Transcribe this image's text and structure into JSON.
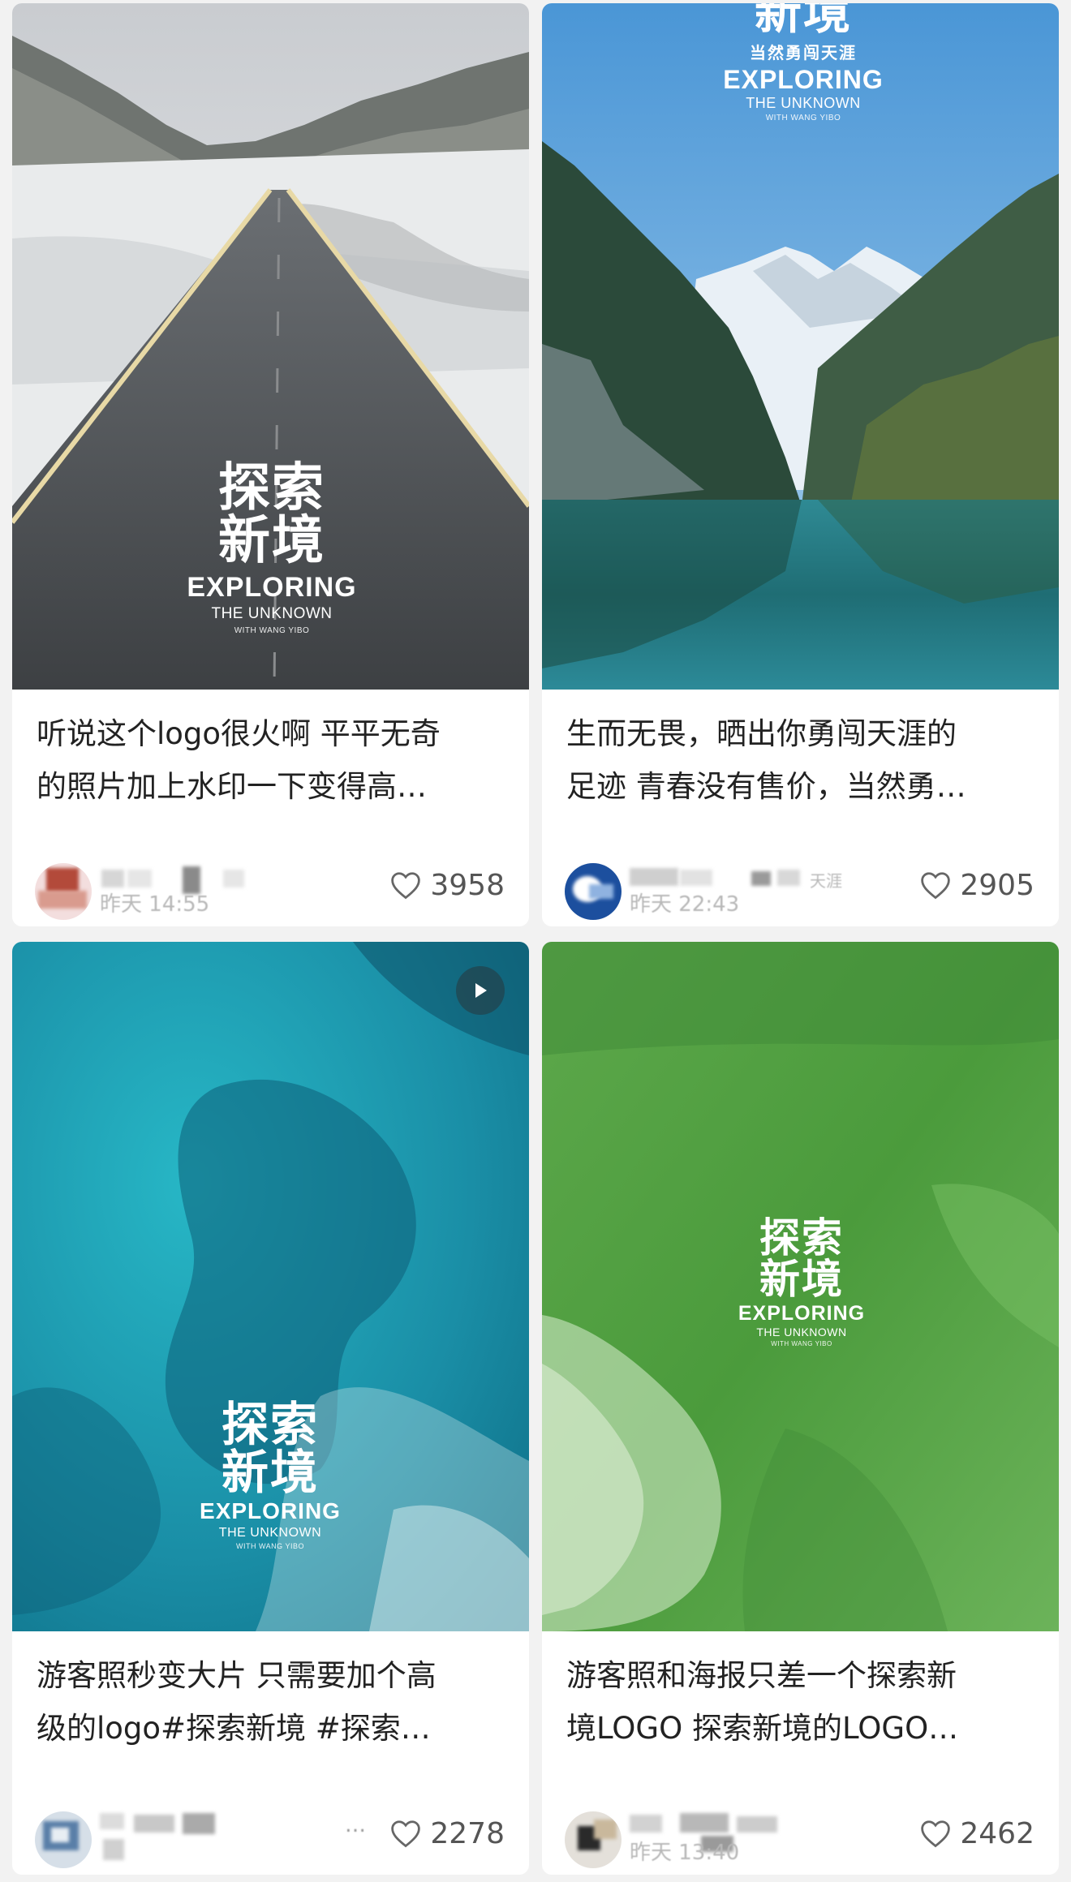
{
  "feed": {
    "cards": [
      {
        "watermark": {
          "line1": "探索",
          "line2": "新境",
          "en1": "EXPLORING",
          "en2": "THE UNKNOWN",
          "en3": "WITH WANG YIBO"
        },
        "title_line1": "听说这个logo很火啊 平平无奇",
        "title_line2": "的照片加上水印一下变得高…",
        "time": "昨天 14:55",
        "likes": "3958"
      },
      {
        "watermark": {
          "line1": "新境",
          "sub": "当然勇闯天涯",
          "en1": "EXPLORING",
          "en2": "THE UNKNOWN",
          "en3": "WITH WANG YIBO"
        },
        "title_line1": "生而无畏，晒出你勇闯天涯的",
        "title_line2": "足迹 青春没有售价，当然勇…",
        "author_suffix": "天涯",
        "time": "昨天 22:43",
        "likes": "2905"
      },
      {
        "watermark": {
          "line1": "探索",
          "line2": "新境",
          "en1": "EXPLORING",
          "en2": "THE UNKNOWN",
          "en3": "WITH WANG YIBO"
        },
        "title_line1": "游客照秒变大片 只需要加个高",
        "title_line2": "级的logo#探索新境 #探索…",
        "author_suffix": "…",
        "likes": "2278",
        "has_video": true
      },
      {
        "watermark": {
          "line1": "探索",
          "line2": "新境",
          "en1": "EXPLORING",
          "en2": "THE UNKNOWN",
          "en3": "WITH WANG YIBO"
        },
        "title_line1": "游客照和海报只差一个探索新",
        "title_line2": "境LOGO 探索新境的LOGO…",
        "time": "昨天 13:40",
        "likes": "2462"
      }
    ]
  },
  "icons": {
    "like": "heart-outline-icon",
    "video": "play-icon"
  },
  "colors": {
    "title_text": "#222222",
    "meta_text": "#b8b8b8",
    "likes_text": "#555555",
    "background": "#f2f2f2"
  }
}
